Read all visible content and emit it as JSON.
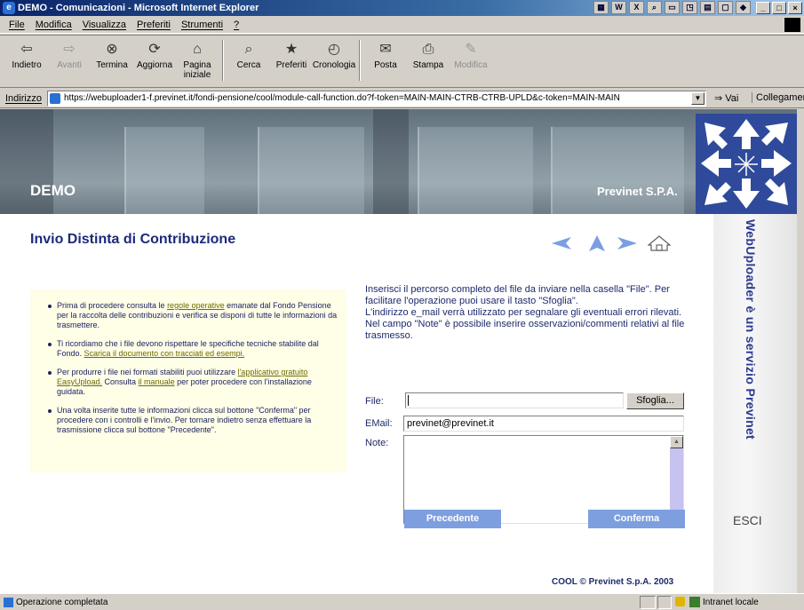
{
  "window": {
    "title": "DEMO - Comunicazioni - Microsoft Internet Explorer",
    "tray_icons": [
      "app-icon",
      "word-icon",
      "excel-icon",
      "search-icon",
      "screen-icon",
      "scan-icon",
      "tile-icon",
      "doc-icon",
      "colors-icon"
    ],
    "controls": [
      "_",
      "□",
      "×"
    ]
  },
  "menu": [
    "File",
    "Modifica",
    "Visualizza",
    "Preferiti",
    "Strumenti",
    "?"
  ],
  "toolbar": [
    {
      "label": "Indietro",
      "icon": "⇦",
      "enabled": true
    },
    {
      "label": "Avanti",
      "icon": "⇨",
      "enabled": false
    },
    {
      "label": "Termina",
      "icon": "⊗",
      "enabled": true
    },
    {
      "label": "Aggiorna",
      "icon": "⟳",
      "enabled": true
    },
    {
      "label": "Pagina iniziale",
      "icon": "⌂",
      "enabled": true
    },
    {
      "label": "Cerca",
      "icon": "⌕",
      "enabled": true
    },
    {
      "label": "Preferiti",
      "icon": "★",
      "enabled": true
    },
    {
      "label": "Cronologia",
      "icon": "◴",
      "enabled": true
    },
    {
      "label": "Posta",
      "icon": "✉",
      "enabled": true
    },
    {
      "label": "Stampa",
      "icon": "⎙",
      "enabled": true
    },
    {
      "label": "Modifica",
      "icon": "✎",
      "enabled": false
    }
  ],
  "address": {
    "label": "Indirizzo",
    "url": "https://webuploader1-f.previnet.it/fondi-pensione/cool/module-call-function.do?f-token=MAIN-MAIN-CTRB-CTRB-UPLD&c-token=MAIN-MAIN",
    "go_label": "Vai",
    "links_label": "Collegamenti"
  },
  "banner": {
    "brand": "DEMO",
    "company": "Previnet S.P.A."
  },
  "side": {
    "vertical_text": "WebUploader è un servizio Previnet",
    "exit_label": "ESCI"
  },
  "page": {
    "title": "Invio Distinta di Contribuzione",
    "accent": "#1d2a7a",
    "note_bg": "#fffee6",
    "button_color": "#7d9fe0"
  },
  "nav_icons": [
    "arrow-left-icon",
    "arrow-up-icon",
    "arrow-right-icon",
    "home-icon"
  ],
  "notes": [
    {
      "pre": "Prima di procedere consulta le ",
      "link": "regole operative",
      "mid": "",
      "link2": "",
      "post": " emanate dal Fondo Pensione per la raccolta delle contribuzioni e verifica se disponi di tutte le informazioni da trasmettere."
    },
    {
      "pre": "Ti ricordiamo che i file devono rispettare le specifiche tecniche stabilite dal Fondo. ",
      "link": "Scarica il documento con tracciati ed esempi.",
      "mid": "",
      "link2": "",
      "post": ""
    },
    {
      "pre": "Per produrre i file nei formati stabiliti puoi utilizzare ",
      "link": "l'applicativo gratuito EasyUpload.",
      "mid": " Consulta ",
      "link2": "il manuale",
      "post": " per poter procedere con l'installazione guidata."
    },
    {
      "pre": "Una volta inserite tutte le informazioni clicca sul bottone \"Conferma\" per procedere con i controlli e l'invio. Per tornare indietro senza effettuare la trasmissione clicca sul bottone \"Precedente\".",
      "link": "",
      "mid": "",
      "link2": "",
      "post": ""
    }
  ],
  "instructions": [
    "Inserisci il percorso completo del file da inviare nella casella \"File\". Per facilitare l'operazione puoi usare il tasto \"Sfoglia\".",
    "L'indirizzo e_mail verrà utilizzato per segnalare gli eventuali errori rilevati.",
    "Nel campo \"Note\" è possibile inserire osservazioni/commenti relativi al file trasmesso."
  ],
  "form": {
    "file_label": "File:",
    "file_value": "",
    "browse_label": "Sfoglia...",
    "email_label": "EMail:",
    "email_value": "previnet@previnet.it",
    "note_label": "Note:",
    "note_value": ""
  },
  "buttons": {
    "previous": "Precedente",
    "confirm": "Conferma"
  },
  "footer": {
    "text": "COOL  © Previnet S.p.A. 2003"
  },
  "status": {
    "text": "Operazione completata",
    "zone": "Intranet locale"
  }
}
